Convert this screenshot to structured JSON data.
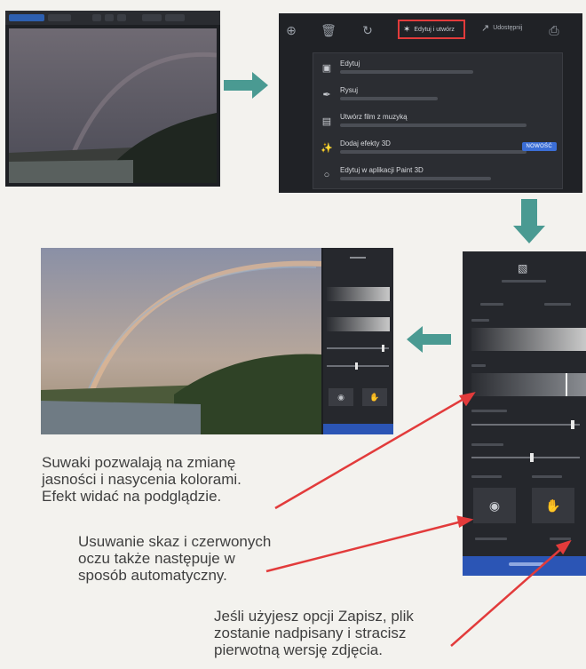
{
  "menu": {
    "toolbar": {
      "edit_create_label": "Edytuj i utwórz",
      "share_label": "Udostępnij"
    },
    "items": [
      {
        "label": "Edytuj",
        "icon": "crop-icon"
      },
      {
        "label": "Rysuj",
        "icon": "pen-icon"
      },
      {
        "label": "Utwórz film z muzyką",
        "icon": "film-icon"
      },
      {
        "label": "Dodaj efekty 3D",
        "icon": "sparkle-3d-icon",
        "badge": "NOWOŚĆ"
      },
      {
        "label": "Edytuj w aplikacji Paint 3D",
        "icon": "paint3d-icon"
      }
    ]
  },
  "colors": {
    "arrow": "#4a9a92",
    "pointer": "#e23b3b",
    "accent_blue": "#2b55b5"
  },
  "captions": {
    "sliders": "Suwaki pozwalają na zmianę\njasności i nasycenia kolorami.\nEfekt widać na podglądzie.",
    "autofix": "Usuwanie skaz i czerwonych\noczu także następuje w\nsposób automatyczny.",
    "save": "Jeśli użyjesz opcji Zapisz, plik\nzostanie nadpisany i stracisz\npierwotną wersję zdjęcia."
  }
}
